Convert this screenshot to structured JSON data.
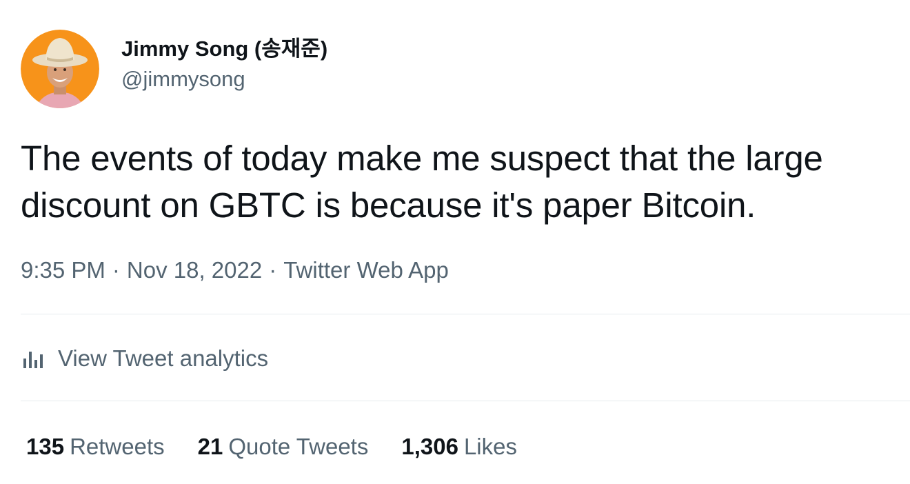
{
  "author": {
    "display_name": "Jimmy Song (송재준)",
    "handle": "@jimmysong",
    "avatar_bg": "#F7931A"
  },
  "tweet": {
    "line1": "The events of today make me suspect that the large",
    "line2": "discount on GBTC is because it's paper Bitcoin."
  },
  "meta": {
    "time": "9:35 PM",
    "separator": "·",
    "date": "Nov 18, 2022",
    "source": "Twitter Web App"
  },
  "analytics": {
    "icon": "bar-chart-icon",
    "label": "View Tweet analytics"
  },
  "stats": [
    {
      "value": "135",
      "label": "Retweets"
    },
    {
      "value": "21",
      "label": "Quote Tweets"
    },
    {
      "value": "1,306",
      "label": "Likes"
    }
  ]
}
